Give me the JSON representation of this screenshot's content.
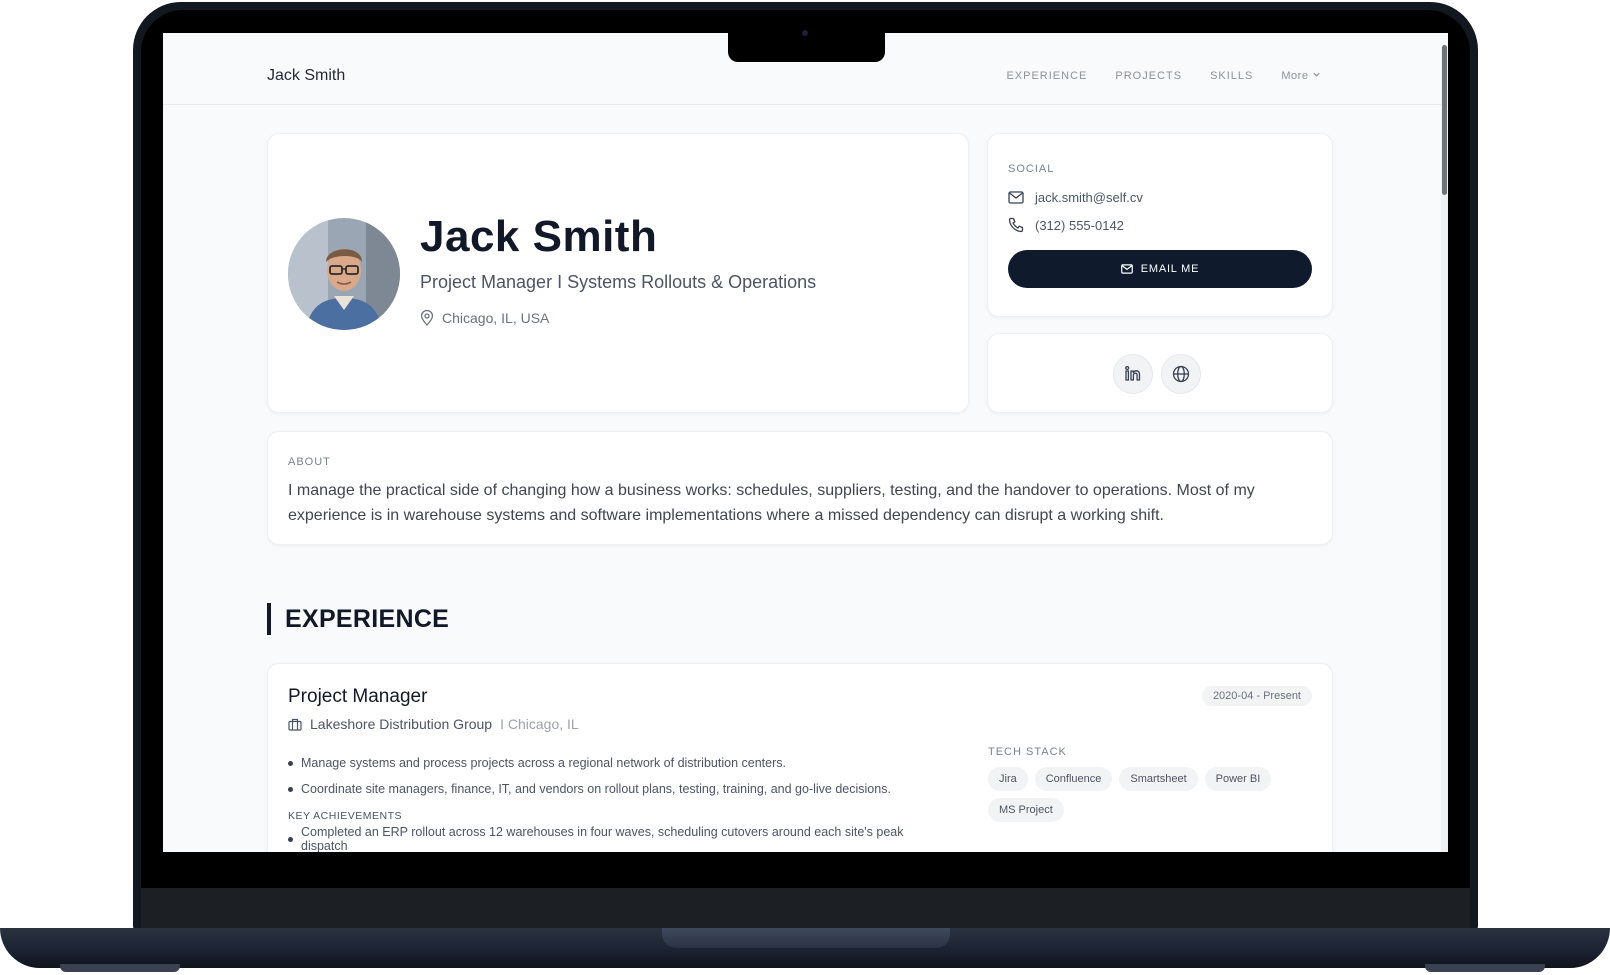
{
  "nav": {
    "brand": "Jack Smith",
    "links": [
      "EXPERIENCE",
      "PROJECTS",
      "SKILLS"
    ],
    "more_label": "More"
  },
  "profile": {
    "name": "Jack Smith",
    "title": "Project Manager I Systems Rollouts & Operations",
    "location": "Chicago, IL, USA"
  },
  "social": {
    "label": "SOCIAL",
    "email": "jack.smith@self.cv",
    "phone": "(312) 555-0142",
    "email_button": "EMAIL ME",
    "icons": [
      "linkedin-icon",
      "globe-icon"
    ]
  },
  "about": {
    "label": "ABOUT",
    "text": "I manage the practical side of changing how a business works: schedules, suppliers, testing, and the handover to operations. Most of my experience is in warehouse systems and software implementations where a missed dependency can disrupt a working shift."
  },
  "experience": {
    "heading": "EXPERIENCE",
    "jobs": [
      {
        "title": "Project Manager",
        "company": "Lakeshore Distribution Group",
        "location": "I Chicago, IL",
        "dates": "2020-04 - Present",
        "bullets": [
          "Manage systems and process projects across a regional network of distribution centers.",
          "Coordinate site managers, finance, IT, and vendors on rollout plans, testing, training, and go-live decisions."
        ],
        "achievements_label": "KEY ACHIEVEMENTS",
        "achievements": [
          "Completed an ERP rollout across 12 warehouses in four waves, scheduling cutovers around each site's peak dispatch"
        ],
        "tech_label": "TECH STACK",
        "tech": [
          "Jira",
          "Confluence",
          "Smartsheet",
          "Power BI",
          "MS Project"
        ]
      }
    ]
  },
  "colors": {
    "accent_dark": "#0f1b2d",
    "text": "#111827",
    "muted": "#6b7280",
    "page_bg": "#f8fafb"
  }
}
